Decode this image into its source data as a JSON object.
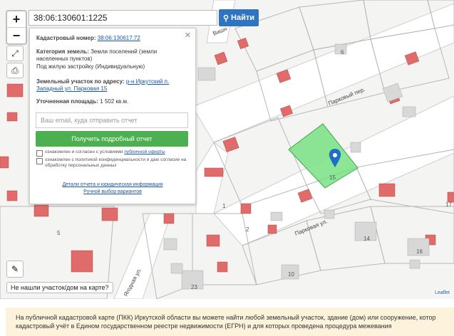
{
  "search": {
    "value": "38:06:130601:1225",
    "button_label": "Найти"
  },
  "zoom": {
    "in": "+",
    "out": "−"
  },
  "panel": {
    "cadastral_label": "Кадастровый номер:",
    "cadastral_value": "38:06:130617:72",
    "category_label": "Категория земель:",
    "category_value": "Земли поселений (земли населенных пунктов)",
    "use_value": "Под жилую застройку (Индивидуальную)",
    "address_label": "Земельный участок по адресу:",
    "address_value": "р-н Иркутский п. Западный ул. Парковая 15",
    "area_label": "Уточненная площадь:",
    "area_value": "1 502 кв.м.",
    "email_placeholder": "Ваш email, куда отправить отчет",
    "get_button": "Получить подробный отчет",
    "check1_text": "ознакомлен и согласен с условиями",
    "check1_link": "публичной оферты",
    "check2_text": "ознакомлен с политикой конфиденциальности и даю согласие на обработку персональных данных",
    "details_link": "Детали отчета и юридическая информация",
    "manual_link": "Ручной выбор вариантов"
  },
  "map_labels": {
    "parkovy_per": "Парковый пер.",
    "parkovaya_ul": "Парковая ул.",
    "yagodnaya_ul": "Ягодная ул.",
    "vish": "Вишн",
    "parcel_15": "15",
    "n6": "6",
    "n5": "5",
    "n14": "14",
    "n16": "16",
    "n23": "23",
    "n10": "10",
    "n1": "1",
    "n2": "2",
    "n17": "17"
  },
  "not_found": "Не нашли участок/дом на карте?",
  "attribution": "Leaflet",
  "notice": "На публичной кадастровой карте (ПКК) Иркутской области вы можете найти любой земельный участок, здание (дом) или сооружение, котор",
  "notice2": "кадастровый учёт в Едином государственном реестре недвижимости (ЕГРН) и для которых проведена процедура межевания",
  "colors": {
    "accent": "#2f74c0",
    "green": "#4caf50",
    "parcel_fill": "#6fe07a",
    "building": "#e06b6b",
    "marker": "#1f6fc4"
  }
}
